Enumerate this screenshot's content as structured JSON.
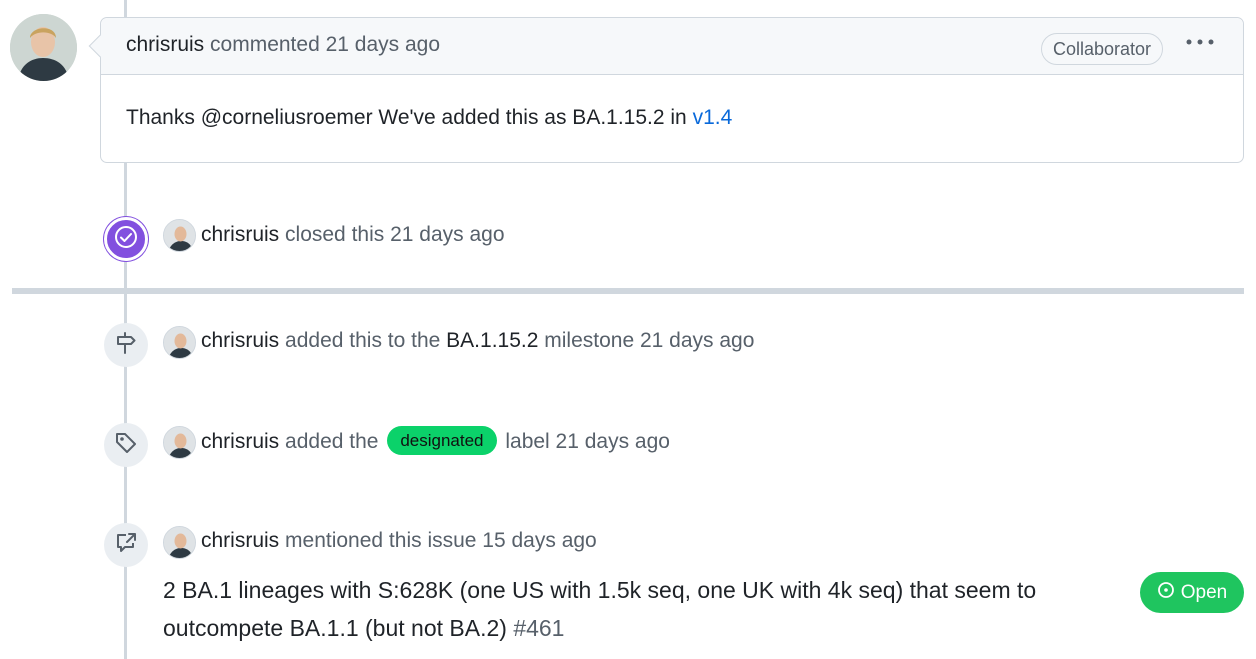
{
  "comment": {
    "author": "chrisruis",
    "action": "commented",
    "time": "21 days ago",
    "role_badge": "Collaborator",
    "menu_icon": "kebab-horizontal-icon",
    "body_text": "Thanks @corneliusroemer We've added this as BA.1.15.2 in ",
    "body_link": "v1.4"
  },
  "events": {
    "closed": {
      "icon": "check-circle-icon",
      "actor": "chrisruis",
      "text": "closed this 21 days ago"
    },
    "milestone": {
      "icon": "milestone-icon",
      "actor": "chrisruis",
      "text_before": "added this to the",
      "milestone_name": "BA.1.15.2",
      "text_after": "milestone 21 days ago"
    },
    "label": {
      "icon": "tag-icon",
      "actor": "chrisruis",
      "text_before": "added the",
      "label_name": "designated",
      "label_color": "#0bd26a",
      "text_after": "label 21 days ago"
    },
    "mention": {
      "icon": "cross-reference-icon",
      "actor": "chrisruis",
      "text": "mentioned this issue 15 days ago",
      "ref_title": "2 BA.1 lineages with S:628K (one US with 1.5k seq, one UK with 4k seq) that seem to outcompete BA.1.1 (but not BA.2)",
      "ref_number": "#461",
      "state_label": "Open",
      "state_color": "#1fc55f"
    }
  },
  "colors": {
    "closed_badge": "#8250df",
    "link": "#0969da",
    "timeline": "#d0d7de"
  }
}
